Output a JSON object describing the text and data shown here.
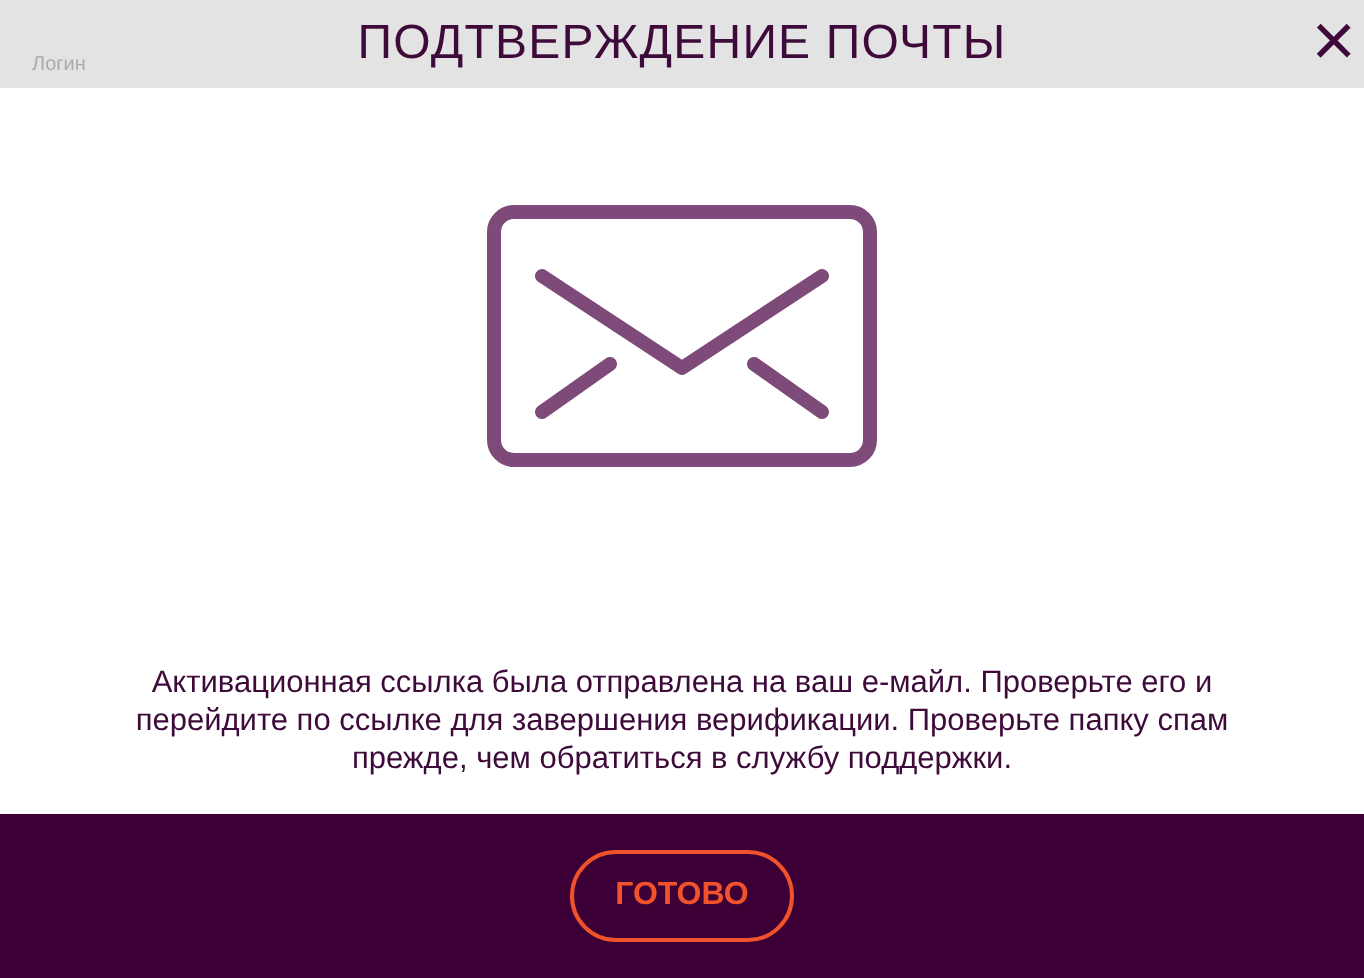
{
  "background": {
    "login_label": "Логин"
  },
  "dialog": {
    "title": "ПОДТВЕРЖДЕНИЕ ПОЧТЫ",
    "close": "×",
    "message": "Активационная ссылка была отправлена на ваш е-майл. Проверьте его и перейдите по ссылке для завершения верификации. Проверьте папку спам прежде, чем обратиться в службу поддержки.",
    "button": "ГОТОВО"
  }
}
